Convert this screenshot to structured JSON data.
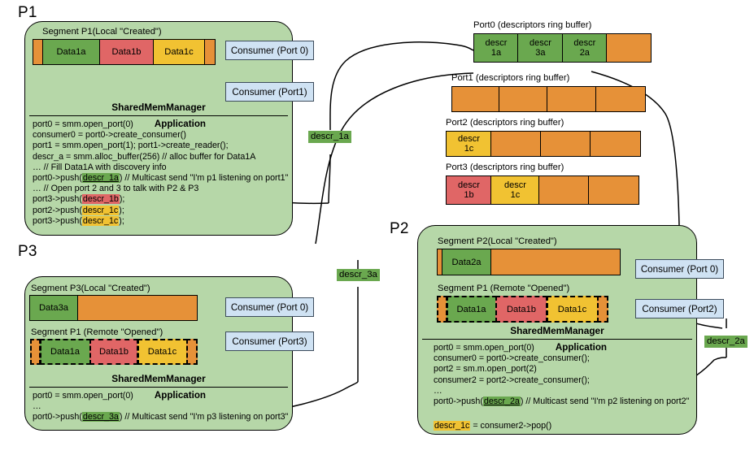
{
  "processes": {
    "p1": {
      "label": "P1",
      "segments": [
        {
          "caption": "Segment P1(Local \"Created\")",
          "blocks": [
            {
              "text": "",
              "color": "orange"
            },
            {
              "text": "Data1a",
              "color": "green"
            },
            {
              "text": "Data1b",
              "color": "red"
            },
            {
              "text": "Data1c",
              "color": "yellow"
            },
            {
              "text": "",
              "color": "orange"
            }
          ]
        }
      ],
      "consumers": [
        "Consumer (Port 0)",
        "Consumer (Port1)"
      ],
      "panel_title": "SharedMemManager",
      "application_label": "Application",
      "code": [
        "port0 = smm.open_port(0)",
        "consumer0 = port0->create_consumer()",
        "port1 = smm.open_port(1); port1->create_reader();",
        "descr_a = smm.alloc_buffer(256) // alloc buffer for Data1A",
        "… // Fill Data1A with discovery info",
        "port0->push(descr_1a) // Multicast send \"I'm p1 listening on port1\"",
        "… // Open port 2 and 3 to talk with P2 & P3",
        "port3->push(descr_1b);",
        "port2->push(descr_1c);",
        "port3->push(descr_1c);"
      ]
    },
    "p2": {
      "label": "P2",
      "segments": [
        {
          "caption": "Segment P2(Local \"Created\")",
          "blocks": [
            {
              "text": "",
              "color": "orange"
            },
            {
              "text": "Data2a",
              "color": "green"
            },
            {
              "text": "",
              "color": "orange"
            }
          ]
        },
        {
          "caption": "Segment P1 (Remote \"Opened\")",
          "blocks": [
            {
              "text": "",
              "color": "orange"
            },
            {
              "text": "Data1a",
              "color": "green"
            },
            {
              "text": "Data1b",
              "color": "red"
            },
            {
              "text": "Data1c",
              "color": "yellow"
            },
            {
              "text": "",
              "color": "orange"
            }
          ]
        }
      ],
      "consumers": [
        "Consumer (Port 0)",
        "Consumer (Port2)"
      ],
      "panel_title": "SharedMemManager",
      "application_label": "Application",
      "code": [
        "port0 = smm.open_port(0)",
        "consumer0 = port0->create_consumer();",
        "port2 = sm.m.open_port(2)",
        "consumer2 = port2->create_consumer();",
        "…",
        "port0->push(descr_2a) // Multicast send \"I'm p2 listening on port2\"",
        "",
        "descr_1c = consumer2->pop()"
      ]
    },
    "p3": {
      "label": "P3",
      "segments": [
        {
          "caption": "Segment P3(Local \"Created\")",
          "blocks": [
            {
              "text": "Data3a",
              "color": "green"
            },
            {
              "text": "",
              "color": "orange"
            }
          ]
        },
        {
          "caption": "Segment P1 (Remote \"Opened\")",
          "blocks": [
            {
              "text": "",
              "color": "orange"
            },
            {
              "text": "Data1a",
              "color": "green"
            },
            {
              "text": "Data1b",
              "color": "red"
            },
            {
              "text": "Data1c",
              "color": "yellow"
            },
            {
              "text": "",
              "color": "orange"
            }
          ]
        }
      ],
      "consumers": [
        "Consumer (Port 0)",
        "Consumer (Port3)"
      ],
      "panel_title": "SharedMemManager",
      "application_label": "Application",
      "code": [
        "port0 = smm.open_port(0)",
        "…",
        "port0->push(descr_3a) // Multicast send \"I'm p3 listening on port3\""
      ]
    }
  },
  "ring_buffers": [
    {
      "caption": "Port0 (descriptors ring buffer)",
      "cells": [
        {
          "l1": "descr",
          "l2": "1a",
          "color": "green"
        },
        {
          "l1": "descr",
          "l2": "3a",
          "color": "green"
        },
        {
          "l1": "descr",
          "l2": "2a",
          "color": "green"
        },
        {
          "l1": "",
          "l2": "",
          "color": "orange"
        }
      ]
    },
    {
      "caption": "Port1 (descriptors ring buffer)",
      "cells": [
        {
          "l1": "",
          "l2": "",
          "color": "orange"
        },
        {
          "l1": "",
          "l2": "",
          "color": "orange"
        },
        {
          "l1": "",
          "l2": "",
          "color": "orange"
        },
        {
          "l1": "",
          "l2": "",
          "color": "orange"
        }
      ]
    },
    {
      "caption": "Port2 (descriptors ring buffer)",
      "cells": [
        {
          "l1": "descr",
          "l2": "1c",
          "color": "yellow"
        },
        {
          "l1": "",
          "l2": "",
          "color": "orange"
        },
        {
          "l1": "",
          "l2": "",
          "color": "orange"
        },
        {
          "l1": "",
          "l2": "",
          "color": "orange"
        }
      ]
    },
    {
      "caption": "Port3 (descriptors ring buffer)",
      "cells": [
        {
          "l1": "descr",
          "l2": "1b",
          "color": "red"
        },
        {
          "l1": "descr",
          "l2": "1c",
          "color": "yellow"
        },
        {
          "l1": "",
          "l2": "",
          "color": "orange"
        },
        {
          "l1": "",
          "l2": "",
          "color": "orange"
        }
      ]
    }
  ],
  "pills": [
    {
      "text": "descr_1a"
    },
    {
      "text": "descr_3a"
    },
    {
      "text": "descr_2a"
    }
  ],
  "colors": {
    "process_fill": "#b6d7a8",
    "green": "#6aa84f",
    "red": "#e06666",
    "yellow": "#f1c232",
    "orange": "#e69138",
    "consumer_fill": "#cfe2f3",
    "stroke": "#000000"
  }
}
